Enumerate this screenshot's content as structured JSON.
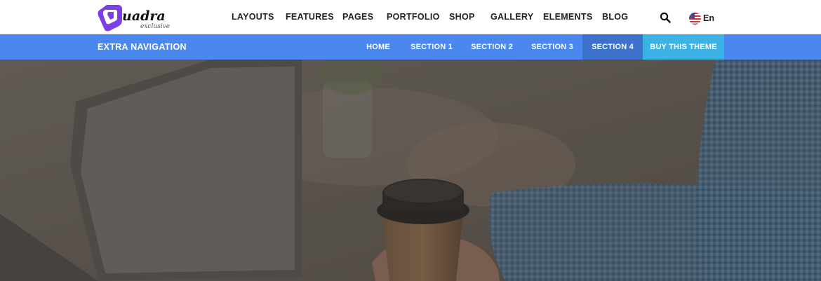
{
  "brand": {
    "logo_text": "uadra",
    "logo_tagline": "exclusive",
    "accent_color": "#7b3fe4"
  },
  "main_nav": {
    "items": [
      {
        "label": "LAYOUTS"
      },
      {
        "label": "FEATURES"
      },
      {
        "label": "PAGES"
      },
      {
        "label": "PORTFOLIO"
      },
      {
        "label": "SHOP"
      },
      {
        "label": "GALLERY"
      },
      {
        "label": "ELEMENTS"
      },
      {
        "label": "BLOG"
      }
    ],
    "search_icon": "search-icon",
    "language": {
      "label": "En",
      "flag": "us-flag-icon"
    }
  },
  "extra_nav": {
    "title": "EXTRA NAVIGATION",
    "bar_color": "#4a88f0",
    "items": [
      {
        "label": "HOME",
        "state": "normal"
      },
      {
        "label": "SECTION 1",
        "state": "normal"
      },
      {
        "label": "SECTION 2",
        "state": "normal"
      },
      {
        "label": "SECTION 3",
        "state": "normal"
      },
      {
        "label": "SECTION 4",
        "state": "active"
      },
      {
        "label": "BUY THIS THEME",
        "state": "cta"
      }
    ],
    "active_color": "#3d72cc",
    "cta_color": "#3cb3e4"
  },
  "hero": {
    "image": "person holding coffee cup beside laptop, dark overlay"
  }
}
